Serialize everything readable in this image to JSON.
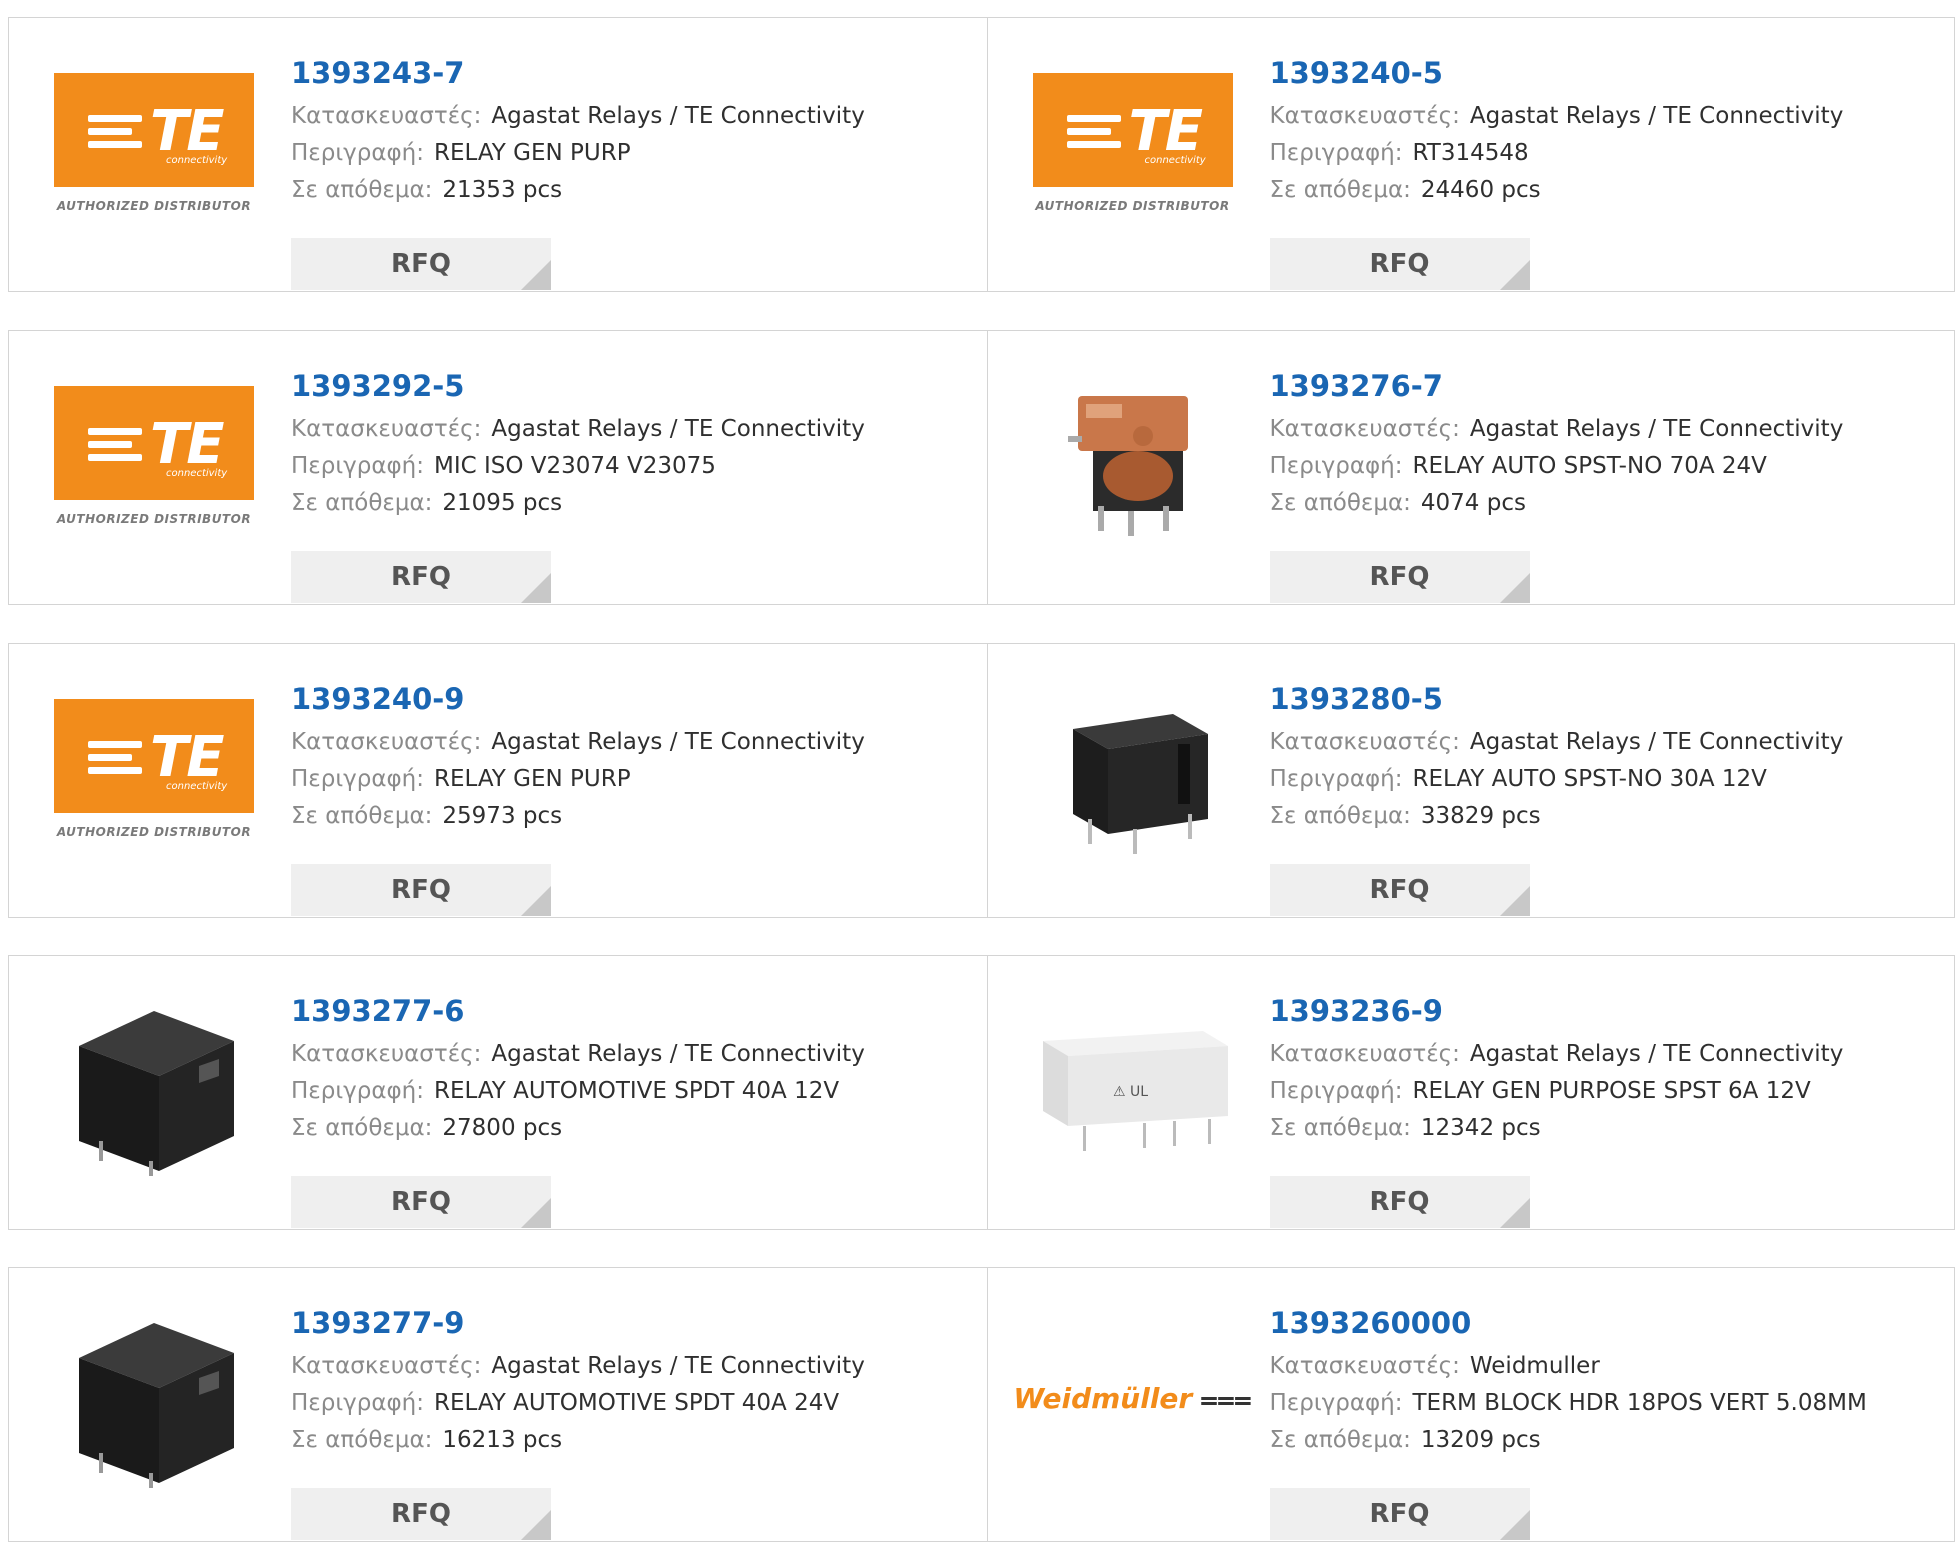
{
  "labels": {
    "manufacturer": "Κατασκευαστές:",
    "description": "Περιγραφή:",
    "stock": "Σε απόθεμα:",
    "rfq": "RFQ"
  },
  "brand": {
    "te_text": "TE",
    "te_sub": "connectivity",
    "te_dist": "AUTHORIZED DISTRIBUTOR",
    "weidmuller": "Weidmüller"
  },
  "products": [
    {
      "pn": "1393243-7",
      "manufacturer": "Agastat Relays / TE Connectivity",
      "description": "RELAY GEN PURP",
      "stock": "21353 pcs",
      "image": "te-logo"
    },
    {
      "pn": "1393240-5",
      "manufacturer": "Agastat Relays / TE Connectivity",
      "description": "RT314548",
      "stock": "24460 pcs",
      "image": "te-logo"
    },
    {
      "pn": "1393292-5",
      "manufacturer": "Agastat Relays / TE Connectivity",
      "description": "MIC ISO V23074 V23075",
      "stock": "21095 pcs",
      "image": "te-logo"
    },
    {
      "pn": "1393276-7",
      "manufacturer": "Agastat Relays / TE Connectivity",
      "description": "RELAY AUTO SPST-NO 70A 24V",
      "stock": "4074 pcs",
      "image": "copper-relay"
    },
    {
      "pn": "1393240-9",
      "manufacturer": "Agastat Relays / TE Connectivity",
      "description": "RELAY GEN PURP",
      "stock": "25973 pcs",
      "image": "te-logo"
    },
    {
      "pn": "1393280-5",
      "manufacturer": "Agastat Relays / TE Connectivity",
      "description": "RELAY AUTO SPST-NO 30A 12V",
      "stock": "33829 pcs",
      "image": "black-relay-small"
    },
    {
      "pn": "1393277-6",
      "manufacturer": "Agastat Relays / TE Connectivity",
      "description": "RELAY AUTOMOTIVE SPDT 40A 12V",
      "stock": "27800 pcs",
      "image": "black-relay-cube"
    },
    {
      "pn": "1393236-9",
      "manufacturer": "Agastat Relays / TE Connectivity",
      "description": "RELAY GEN PURPOSE SPST 6A 12V",
      "stock": "12342 pcs",
      "image": "white-relay"
    },
    {
      "pn": "1393277-9",
      "manufacturer": "Agastat Relays / TE Connectivity",
      "description": "RELAY AUTOMOTIVE SPDT 40A 24V",
      "stock": "16213 pcs",
      "image": "black-relay-cube"
    },
    {
      "pn": "1393260000",
      "manufacturer": "Weidmuller",
      "description": "TERM BLOCK HDR 18POS VERT 5.08MM",
      "stock": "13209 pcs",
      "image": "weidmuller-logo"
    }
  ]
}
